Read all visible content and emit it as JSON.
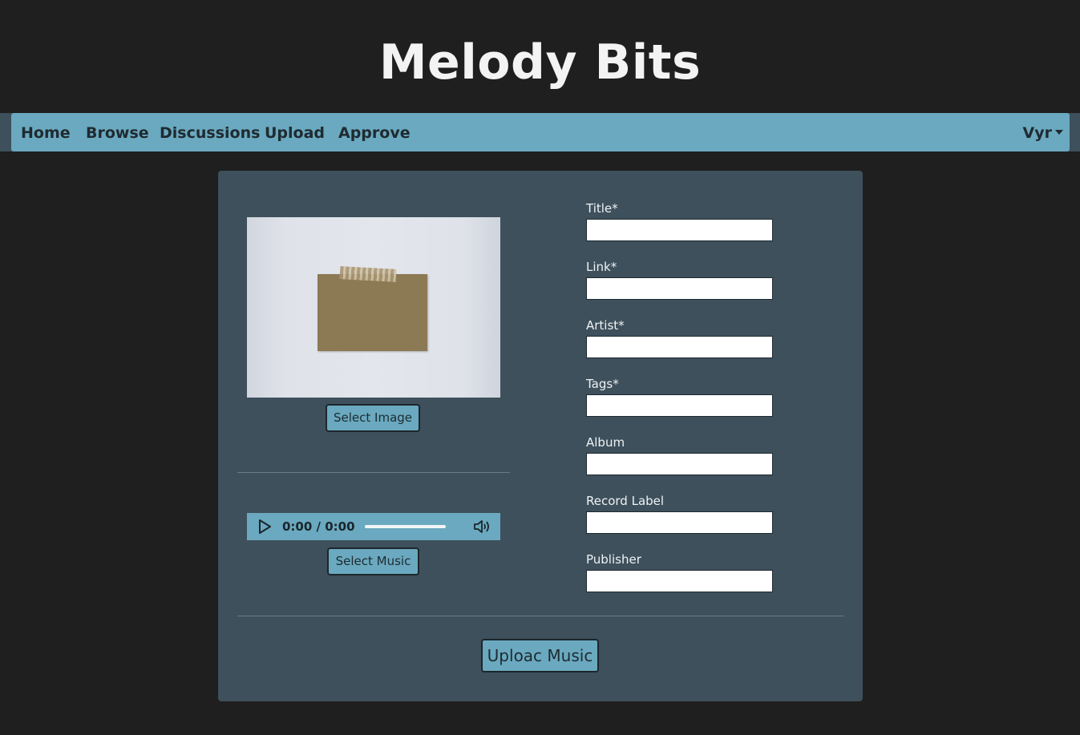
{
  "site": {
    "title": "Melody Bits"
  },
  "nav": {
    "links": [
      "Home",
      "Browse",
      "Discussions",
      "Upload",
      "Approve"
    ],
    "user": "Vyr"
  },
  "media": {
    "select_image_label": "Select Image",
    "select_music_label": "Select Music",
    "audio": {
      "time": "0:00 / 0:00",
      "progress": 0
    }
  },
  "form": {
    "fields": [
      {
        "label": "Title*",
        "value": ""
      },
      {
        "label": "Link*",
        "value": ""
      },
      {
        "label": "Artist*",
        "value": ""
      },
      {
        "label": "Tags*",
        "value": ""
      },
      {
        "label": "Album",
        "value": ""
      },
      {
        "label": "Record Label",
        "value": ""
      },
      {
        "label": "Publisher",
        "value": ""
      }
    ],
    "submit_label": "Uploac Music"
  },
  "icons": {
    "play": "play-icon",
    "volume": "volume-icon",
    "caret": "chevron-down-icon"
  },
  "colors": {
    "background": "#1f1f1f",
    "accent": "#6aa9bf",
    "panel": "#3e505c"
  }
}
